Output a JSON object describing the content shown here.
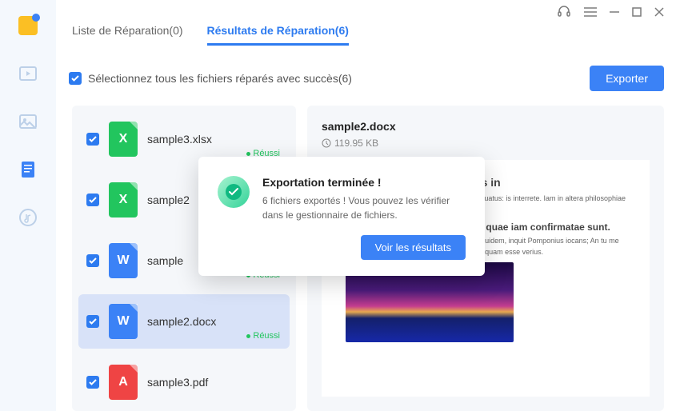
{
  "tabs": {
    "repair_list": "Liste de Réparation(0)",
    "repair_results": "Résultats de Réparation(6)"
  },
  "toolbar": {
    "select_all": "Sélectionnez tous les fichiers réparés avec succès(6)",
    "export": "Exporter"
  },
  "files": [
    {
      "name": "sample3.xlsx",
      "badge": "Réussi",
      "type": "xlsx",
      "selected": false
    },
    {
      "name": "sample2",
      "badge": "",
      "type": "xlsx",
      "selected": false
    },
    {
      "name": "sample",
      "badge": "Réussi",
      "type": "docx",
      "selected": false
    },
    {
      "name": "sample2.docx",
      "badge": "Réussi",
      "type": "docx",
      "selected": true
    },
    {
      "name": "sample3.pdf",
      "badge": "",
      "type": "pdf",
      "selected": false
    }
  ],
  "preview": {
    "title": "sample2.docx",
    "size": "119.95 KB",
    "doc": {
      "h1": "ium consumptum videmus in",
      "p1": "tis elicit. Quid enim honeste dicit? Tum Torquatus: is interrete. Iam in altera philosophiae parte. Sed haec ducamus. Nihil sane.",
      "h2": "Expressa vero in iis aetatibus, quae iam confirmatae sunt.",
      "p2": "Sit sane ista voluptas. Non quam nostram quidem, inquit Pomponius iocans; An tu me de L. Sed haec omittamus; Cave putes quicquam esse verius."
    }
  },
  "modal": {
    "title": "Exportation terminée !",
    "message": "6 fichiers exportés ! Vous pouvez les vérifier dans le gestionnaire de fichiers.",
    "button": "Voir les résultats"
  },
  "icon_letters": {
    "xlsx": "X",
    "docx": "W",
    "pdf": "A"
  }
}
